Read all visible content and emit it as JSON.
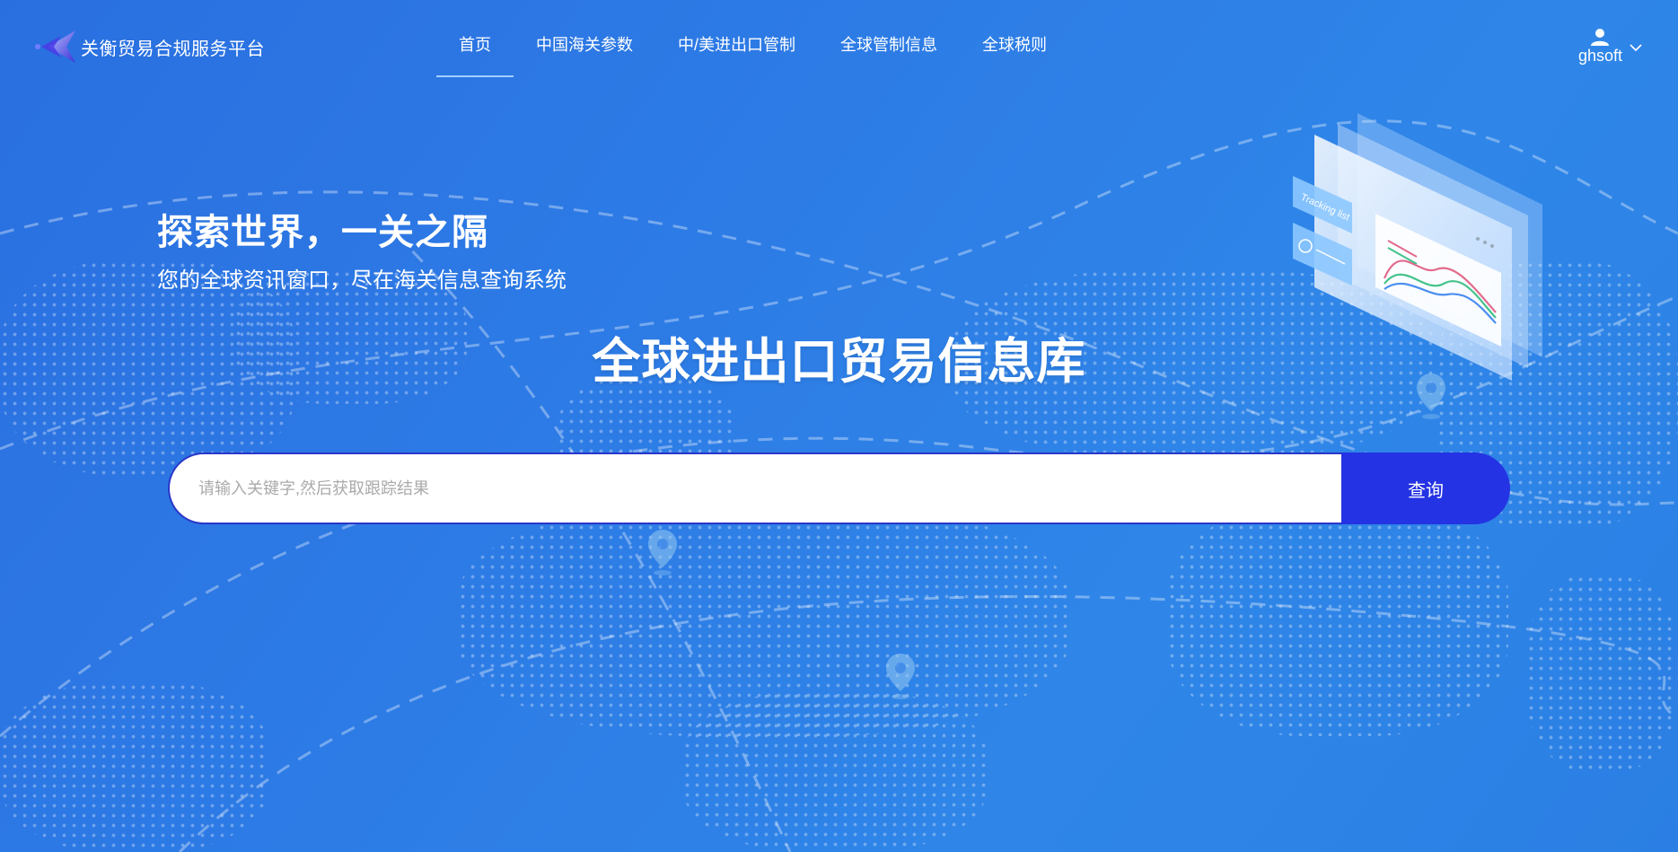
{
  "header": {
    "brand": "关衡贸易合规服务平台",
    "nav": [
      {
        "label": "首页",
        "active": true
      },
      {
        "label": "中国海关参数",
        "active": false
      },
      {
        "label": "中/美进出口管制",
        "active": false
      },
      {
        "label": "全球管制信息",
        "active": false
      },
      {
        "label": "全球税则",
        "active": false
      }
    ],
    "user": {
      "name": "ghsoft",
      "icon": "user-icon",
      "dropdown_icon": "chevron-down-icon"
    }
  },
  "hero": {
    "slogan": "探索世界，一关之隔",
    "sub_slogan": "您的全球资讯窗口，尽在海关信息查询系统",
    "title": "全球进出口贸易信息库"
  },
  "search": {
    "placeholder": "请输入关键字,然后获取跟踪结果",
    "value": "",
    "button_label": "查询"
  },
  "illustration": {
    "label": "Tracking list"
  },
  "colors": {
    "background": "#2d7ce6",
    "search_button": "#2433e3",
    "search_border": "#2a36c8",
    "nav_active_underline": "#9fd0ff"
  }
}
